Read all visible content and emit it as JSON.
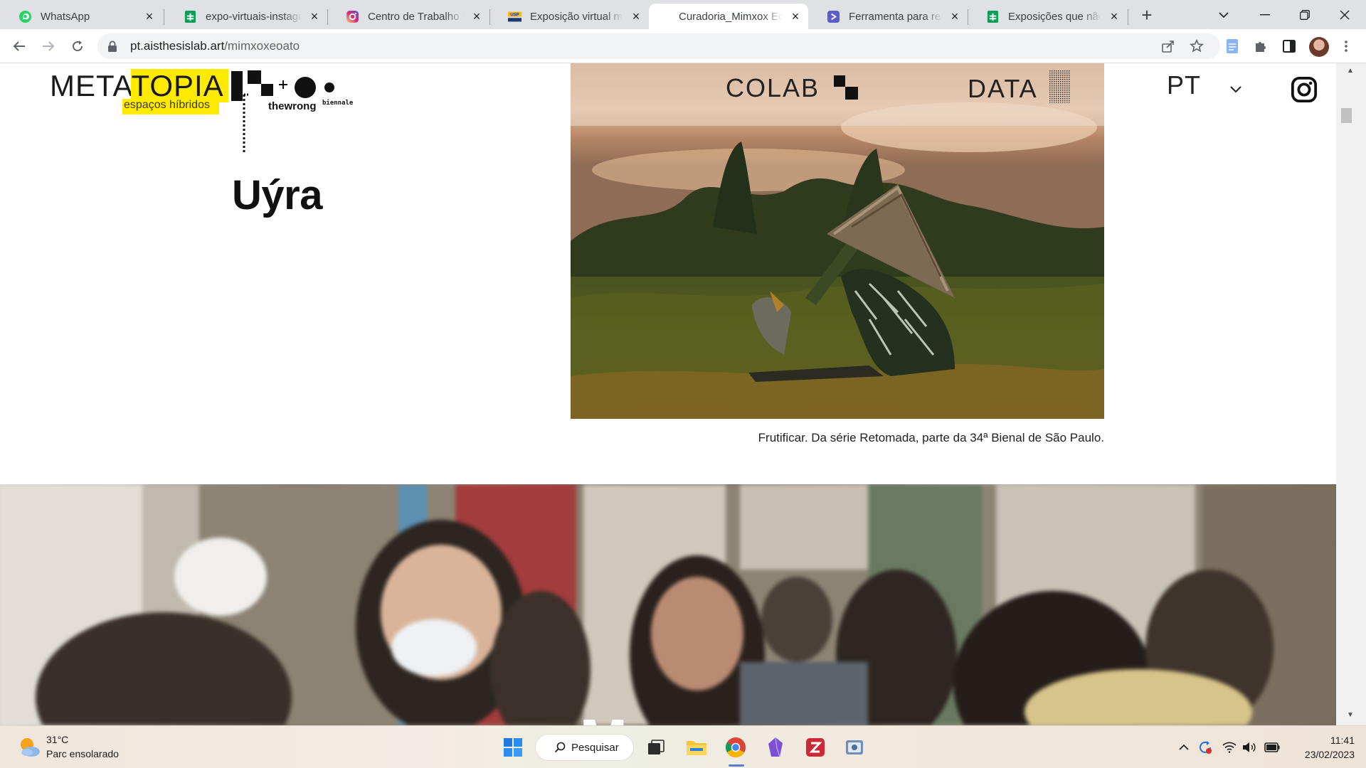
{
  "browser": {
    "tabs": [
      {
        "title": "WhatsApp",
        "icon": "whatsapp-icon"
      },
      {
        "title": "expo-virtuais-instagram",
        "icon": "sheets-icon"
      },
      {
        "title": "Centro de Trabalho In",
        "icon": "instagram-icon"
      },
      {
        "title": "Exposição virtual mos",
        "icon": "usp-icon"
      },
      {
        "title": "Curadoria_Mimxox Ec",
        "icon": "none",
        "active": true
      },
      {
        "title": "Ferramenta para rem",
        "icon": "gradio-icon"
      },
      {
        "title": "Exposições que não p",
        "icon": "sheets-icon"
      }
    ],
    "new_tab": "+",
    "url_host": "pt.aisthesislab.art",
    "url_path": "/mimxoxeoato"
  },
  "page": {
    "logo_meta": "META",
    "logo_topia": "TOPIA",
    "logo_sub": "espaços híbridos",
    "wrong_logo": "thewrong",
    "wrong_logo_sup": "biennale",
    "artist_name": "Uýra",
    "nav": {
      "colab": "COLAB",
      "data": "DATA",
      "language": "PT"
    },
    "image_caption": "Frutificar. Da série Retomada, parte da 34ª Bienal de São Paulo.",
    "band2_letter": "M"
  },
  "taskbar": {
    "weather_temp": "31°C",
    "weather_desc": "Parc ensolarado",
    "search_label": "Pesquisar",
    "time": "11:41",
    "date": "23/02/2023"
  },
  "colors": {
    "logo_yellow": "#ffea00",
    "chrome_tab_bar": "#dfe1e5",
    "omnibox": "#f1f3f4"
  }
}
